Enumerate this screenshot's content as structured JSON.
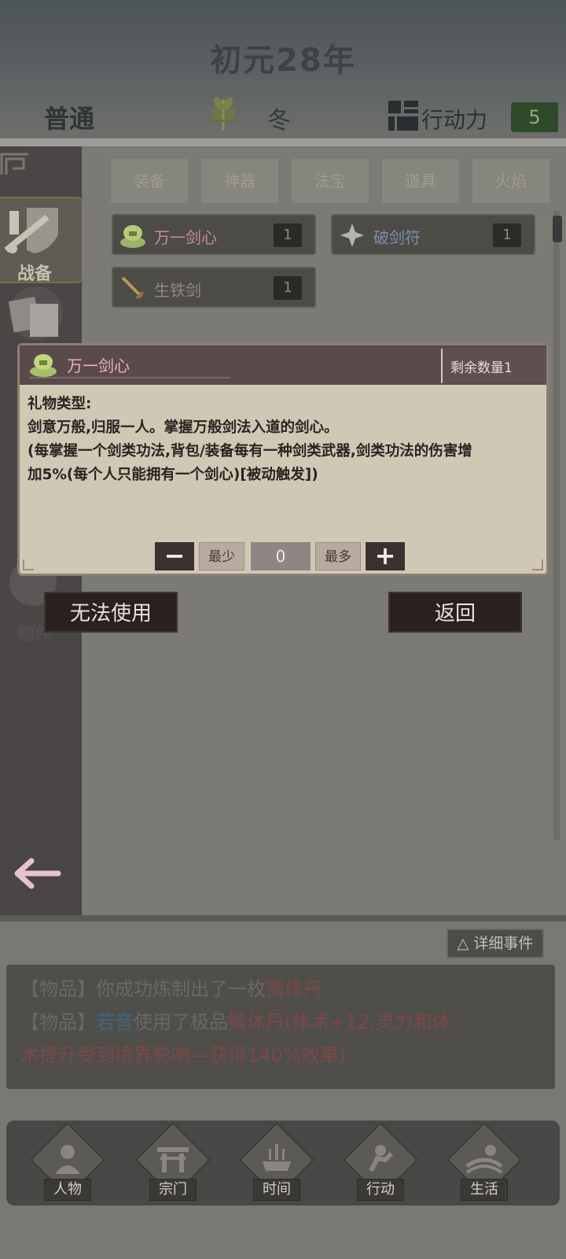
{
  "header": {
    "year": "初元28年",
    "mode": "普通",
    "season": "冬",
    "ap_label": "行动力",
    "ap_value": "5"
  },
  "rail": {
    "active_label": "战备",
    "item_label": "物件"
  },
  "tabs": [
    "装备",
    "神器",
    "法宝",
    "道具",
    "火焰"
  ],
  "items": [
    {
      "name": "万一剑心",
      "count": "1",
      "color": "#c98aa0",
      "icon": "sword-heart-icon"
    },
    {
      "name": "破剑符",
      "count": "1",
      "color": "#7d8bb0",
      "icon": "talisman-star-icon"
    },
    {
      "name": "生铁剑",
      "count": "1",
      "color": "#8e8a80",
      "icon": "iron-sword-icon"
    }
  ],
  "popup": {
    "title": "万一剑心",
    "remain": "剩余数量1",
    "line1": "礼物类型:",
    "line2": "剑意万般,归服一人。掌握万般剑法入道的剑心。",
    "line3": "(每掌握一个剑类功法,背包/装备每有一种剑类武器,剑类功法的伤害增",
    "line4": "加5%(每个人只能拥有一个剑心)[被动触发])",
    "minus": "−",
    "min_label": "最少",
    "qty": "0",
    "max_label": "最多",
    "plus": "+"
  },
  "actions": {
    "use": "无法使用",
    "back": "返回"
  },
  "log": {
    "detail_btn": "△ 详细事件",
    "l1_tag": "【物品】",
    "l1_text": "你成功炼制出了一枚",
    "l1_item": "锻体丹",
    "l2_tag": "【物品】",
    "l2_name": "若音",
    "l2_text": "使用了极品",
    "l2_item": "锻体丹",
    "l2_effect": "(体术+12,灵力和体",
    "l3_effect": "术提升受到境界影响—获得140%效果)"
  },
  "nav": [
    {
      "label": "人物",
      "icon": "person-icon"
    },
    {
      "label": "宗门",
      "icon": "sect-gate-icon"
    },
    {
      "label": "时间",
      "icon": "incense-icon"
    },
    {
      "label": "行动",
      "icon": "action-icon"
    },
    {
      "label": "生活",
      "icon": "life-icon"
    }
  ],
  "colors": {
    "accent_green": "#92ae7a",
    "popup_bg": "#d0c8b5",
    "popup_head": "#5b4a4c"
  }
}
